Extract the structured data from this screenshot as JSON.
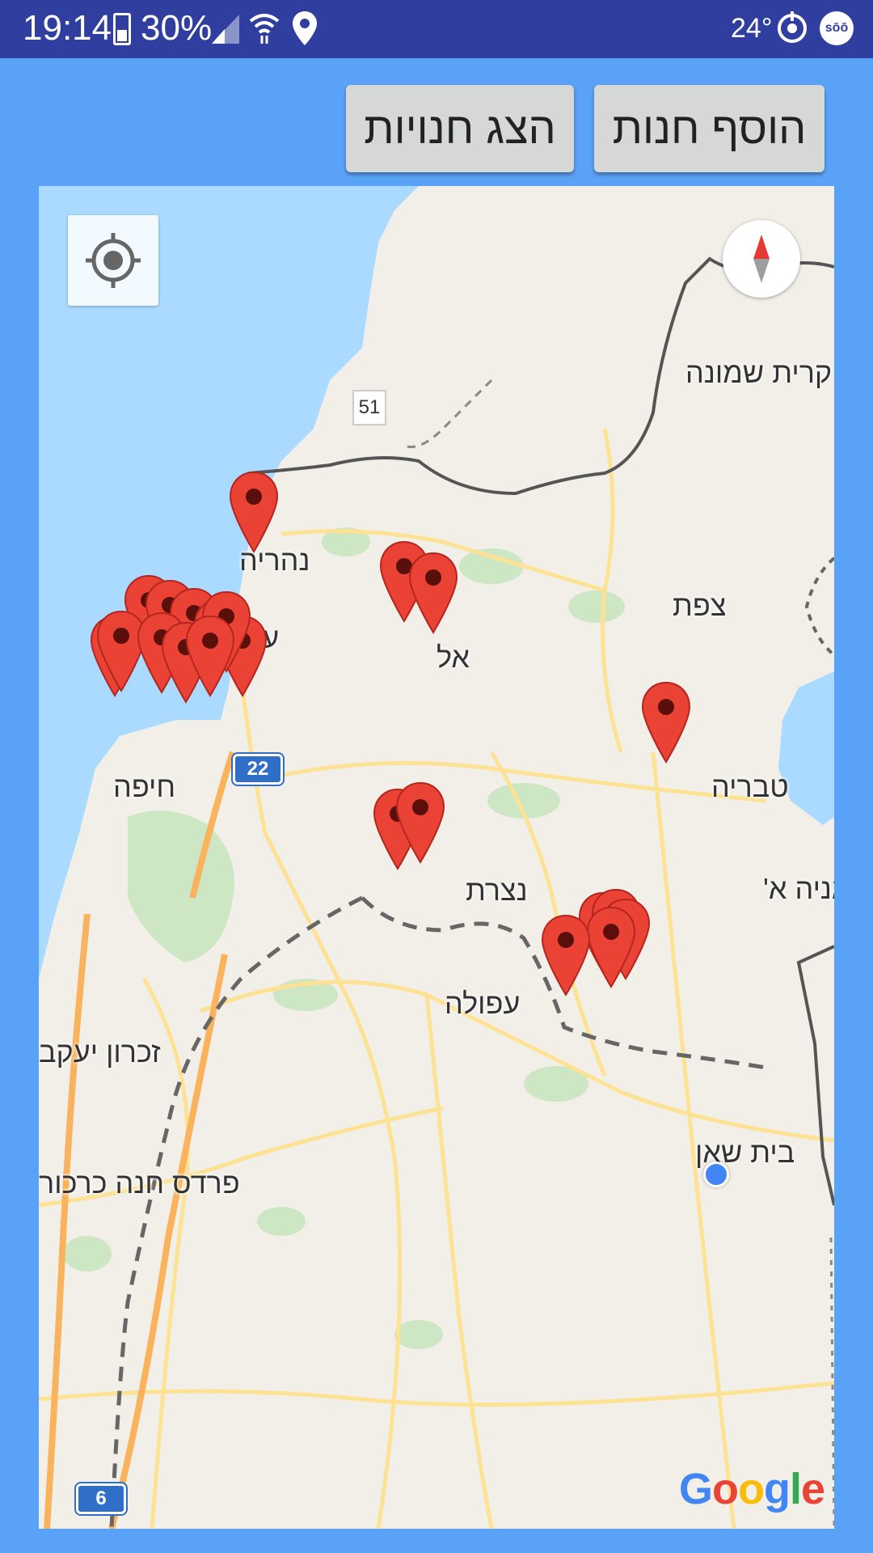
{
  "status_bar": {
    "time": "19:14",
    "battery": "30%",
    "temperature": "24°",
    "app_badge": "sōō"
  },
  "buttons": {
    "show_stores": "הצג חנויות",
    "add_store": "הוסף חנות"
  },
  "map": {
    "labels": {
      "kiryat_shmona": "קרית שמונה",
      "nahariya": "נהריה",
      "akko": "עכו",
      "tzfat": "צפת",
      "karmiel_partial": "אל",
      "tiberias": "טבריה",
      "haifa": "חיפה",
      "nazareth_partial": "נצרת",
      "afula": "עפולה",
      "degania_partial": "גניה א'",
      "zichron": "זכרון יעקב",
      "pardes_hanna": "פרדס חנה כרכור",
      "beit_shean": "בית שאן"
    },
    "road_numbers": {
      "route_51": "51",
      "route_22": "22",
      "route_6": "6"
    },
    "attribution": "Google",
    "colors": {
      "water": "#aadaff",
      "land": "#f2efe9",
      "park": "#cde6c3",
      "road": "#fde293",
      "highway": "#f9b35d",
      "marker": "#ea4335",
      "my_location": "#4285f4"
    }
  }
}
